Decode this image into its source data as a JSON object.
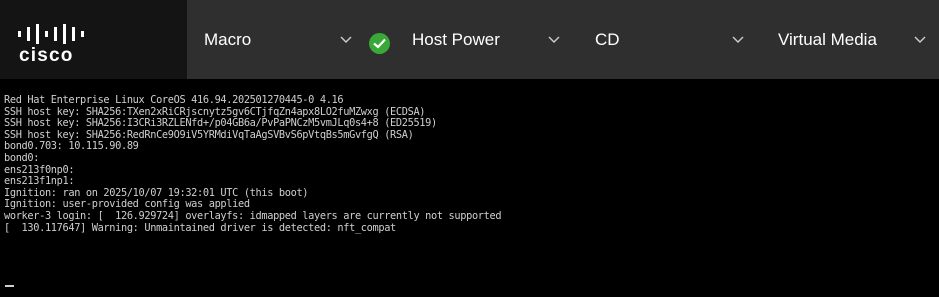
{
  "brand": {
    "logo_text": "cisco",
    "logo_icon": "cisco-bars-logo"
  },
  "menus": [
    {
      "label": "Macro",
      "icon": "chevron-down-icon"
    },
    {
      "label": "Host Power",
      "icon": "chevron-down-icon",
      "status_icon": "check-circle-icon",
      "status_color": "#3aa839"
    },
    {
      "label": "CD",
      "icon": "chevron-down-icon"
    },
    {
      "label": "Virtual Media",
      "icon": "chevron-down-icon"
    }
  ],
  "console": {
    "lines": [
      "Red Hat Enterprise Linux CoreOS 416.94.202501270445-0 4.16",
      "SSH host key: SHA256:TXen2xRiCRjscnytz5gv6CTjfqZn4apx8LO2fuMZwxg (ECDSA)",
      "SSH host key: SHA256:I3CRi3RZLENfd+/p04GB6a/PvPaPNCzM5vmJLq0s4+8 (ED25519)",
      "SSH host key: SHA256:RedRnCe9O9iV5YRMdiVqTaAgSVBvS6pVtqBs5mGvfgQ (RSA)",
      "bond0.703: 10.115.90.89",
      "bond0:",
      "ens213f0np0:",
      "ens213f1np1:",
      "Ignition: ran on 2025/10/07 19:32:01 UTC (this boot)",
      "Ignition: user-provided config was applied",
      "worker-3 login: [  126.929724] overlayfs: idmapped layers are currently not supported",
      "[  130.117647] Warning: Unmaintained driver is detected: nft_compat"
    ]
  },
  "colors": {
    "topbar": "#2f2f2f",
    "logo_panel": "#141414",
    "console_bg": "#000000",
    "console_text": "#cfcfcf",
    "success": "#3aa839"
  }
}
